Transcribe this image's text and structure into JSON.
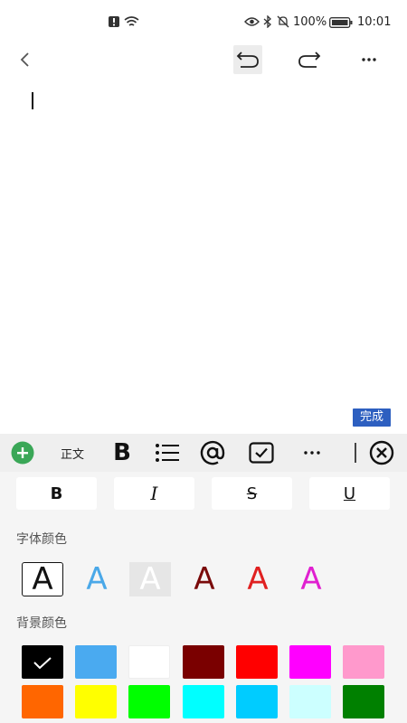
{
  "status_bar": {
    "battery_percent": "100%",
    "time": "10:01"
  },
  "editor": {
    "content": ""
  },
  "done_label": "完成",
  "toolbar": {
    "style_label": "正文",
    "bold_label": "B"
  },
  "text_styles": {
    "bold": "B",
    "italic": "I",
    "strikethrough": "S",
    "underline": "U"
  },
  "font_color_label": "字体颜色",
  "background_color_label": "背景颜色",
  "font_colors": [
    {
      "glyph": "A",
      "color": "#111111",
      "selected": true
    },
    {
      "glyph": "A",
      "color": "#4aa8e8",
      "selected": false
    },
    {
      "glyph": "A",
      "color": "#ffffff",
      "selected": false
    },
    {
      "glyph": "A",
      "color": "#7a0a0a",
      "selected": false
    },
    {
      "glyph": "A",
      "color": "#e02020",
      "selected": false
    },
    {
      "glyph": "A",
      "color": "#e020d0",
      "selected": false
    }
  ],
  "background_colors": [
    "#000000",
    "#4aaaf0",
    "#ffffff",
    "#7a0000",
    "#ff0000",
    "#ff00ff",
    "#ff99cc",
    "#ff6600",
    "#ffff00",
    "#00ff00",
    "#00ffff",
    "#00ccff",
    "#ccffff",
    "#008000"
  ],
  "selected_background_index": 0
}
